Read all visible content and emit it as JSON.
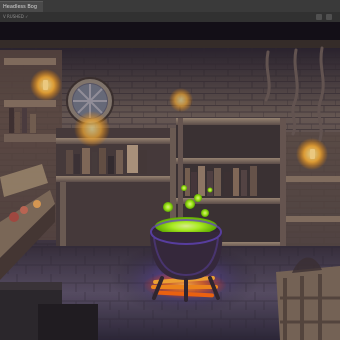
{
  "window": {
    "tab_title": "Headless Bog",
    "toolbar_info": "V RUSHED ✓"
  },
  "colors": {
    "potion": "#b6ff1f",
    "fire": "#ff7a1a",
    "magic_glow": "#7b55ff",
    "wall": "#8f7a70",
    "floor": "#6c6378"
  },
  "icons": [
    "file-tab-icon",
    "viewport-tool-icon",
    "render-settings-icon"
  ]
}
